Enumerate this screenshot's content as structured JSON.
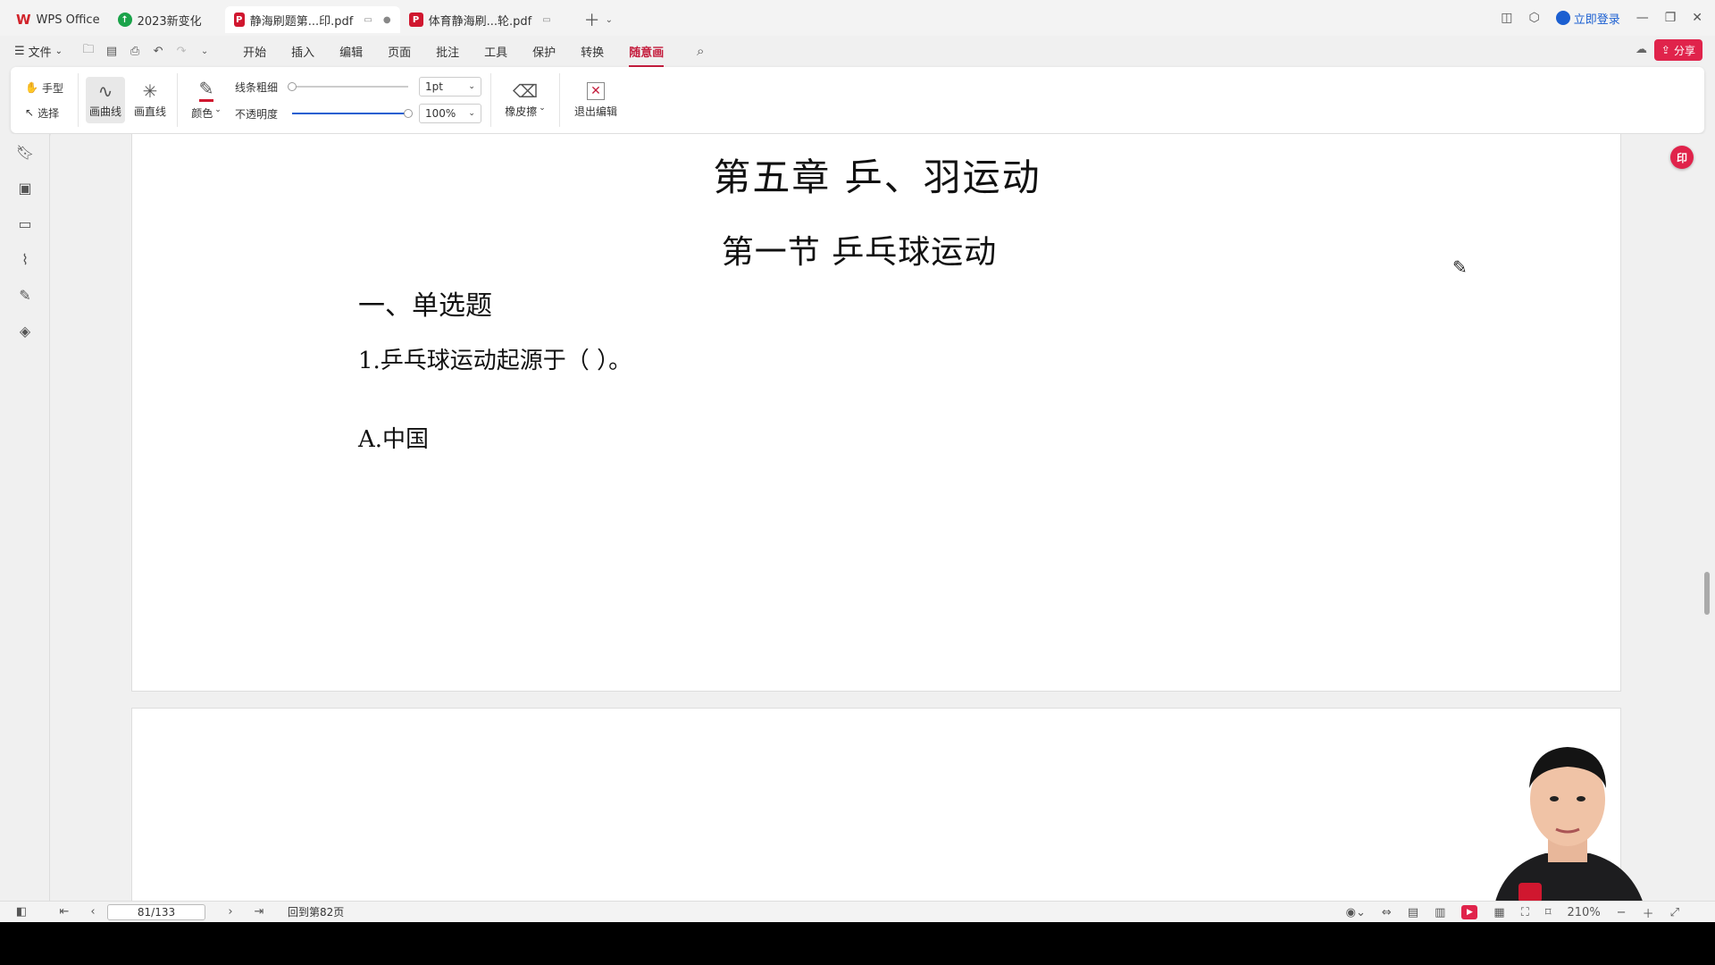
{
  "tabs": [
    {
      "label": "WPS Office",
      "icon": "wps-logo-icon"
    },
    {
      "label": "2023新变化",
      "icon": "upgrade-icon"
    },
    {
      "label": "静海刷题第...印.pdf",
      "icon": "pdf-icon",
      "active": true
    },
    {
      "label": "体育静海刷...轮.pdf",
      "icon": "pdf-icon"
    }
  ],
  "window": {
    "login": "立即登录"
  },
  "menubar": {
    "file": "文件",
    "items": [
      "开始",
      "插入",
      "编辑",
      "页面",
      "批注",
      "工具",
      "保护",
      "转换",
      "随意画"
    ],
    "active": "随意画",
    "share": "分享"
  },
  "ribbon": {
    "hand": "手型",
    "select": "选择",
    "draw_curve": "画曲线",
    "draw_line": "画直线",
    "color": "颜色",
    "line_width_label": "线条粗细",
    "line_width_value": "1pt",
    "opacity_label": "不透明度",
    "opacity_value": "100%",
    "eraser": "橡皮擦",
    "exit_edit": "退出编辑",
    "pen_color": "#d0172f",
    "line_width_fraction": 0.0,
    "opacity_fraction": 1.0
  },
  "document": {
    "chapter_title": "第五章  乒、羽运动",
    "section_title": "第一节  乒乓球运动",
    "question_type": "一、单选题",
    "question": "1.乒乓球运动起源于（  ）。",
    "option_a": "A.中国"
  },
  "floating_badge": "印",
  "statusbar": {
    "page_input": "81/133",
    "back_to_page": "回到第82页",
    "zoom": "210%"
  },
  "colors": {
    "accent": "#c41d3d",
    "share": "#e0234b",
    "link": "#1b5fd1"
  }
}
